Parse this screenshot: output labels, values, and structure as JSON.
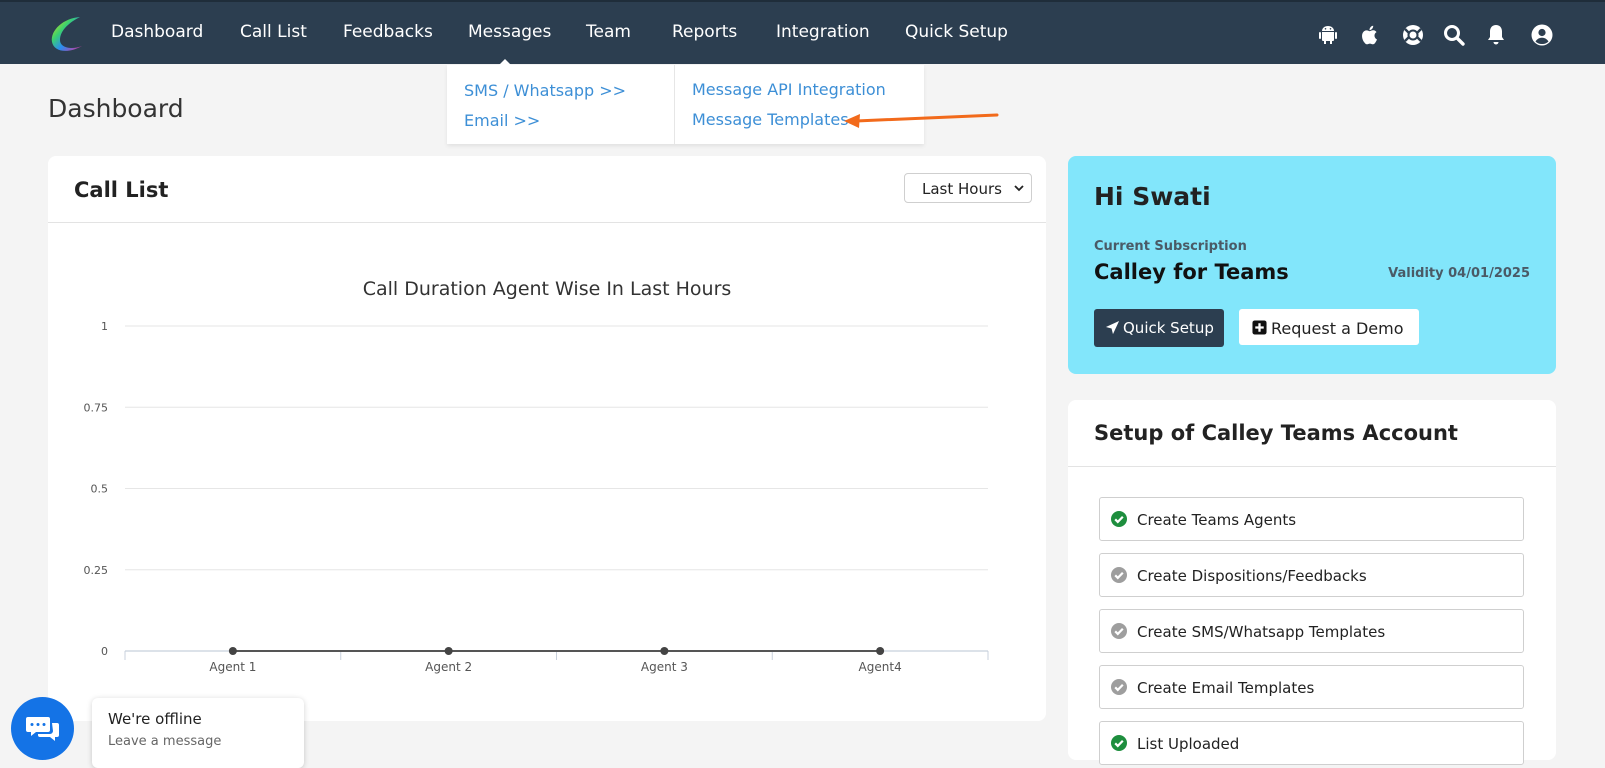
{
  "nav": {
    "items": [
      {
        "label": "Dashboard",
        "active": true
      },
      {
        "label": "Call List",
        "active": false
      },
      {
        "label": "Feedbacks",
        "active": false
      },
      {
        "label": "Messages",
        "active": true
      },
      {
        "label": "Team",
        "active": false
      },
      {
        "label": "Reports",
        "active": false
      },
      {
        "label": "Integration",
        "active": false
      },
      {
        "label": "Quick Setup",
        "active": false
      }
    ],
    "icons": [
      "android-icon",
      "apple-icon",
      "help-lifebuoy-icon",
      "search-icon",
      "notification-bell-icon",
      "user-account-icon"
    ],
    "accent_color": "#3d9be9",
    "bg_color": "#2c3e50"
  },
  "messages_menu": {
    "col1": [
      "SMS / Whatsapp >>",
      "Email >>"
    ],
    "col2": [
      "Message API Integration",
      "Message Templates"
    ]
  },
  "page": {
    "title": "Dashboard"
  },
  "call_list": {
    "title": "Call List",
    "filter_value": "Last Hours"
  },
  "chart_data": {
    "type": "line",
    "title": "Call Duration Agent Wise In Last Hours",
    "categories": [
      "Agent 1",
      "Agent 2",
      "Agent 3",
      "Agent4"
    ],
    "series": [
      {
        "values": [
          0,
          0,
          0,
          0
        ]
      }
    ],
    "ylim": [
      0,
      1
    ],
    "yticks": [
      "1",
      "0.75",
      "0.5",
      "0.25",
      "0"
    ],
    "grid": true,
    "xlabel": "",
    "ylabel": ""
  },
  "welcome": {
    "greeting": "Hi Swati",
    "subscription_label": "Current Subscription",
    "plan": "Calley for Teams",
    "validity": "Validity 04/01/2025",
    "quick_setup_label": "Quick Setup",
    "request_demo_label": "Request a Demo",
    "bg_color": "#82e6fb"
  },
  "setup": {
    "title": "Setup of Calley Teams Account",
    "items": [
      {
        "label": "Create Teams Agents",
        "done": true
      },
      {
        "label": "Create Dispositions/Feedbacks",
        "done": false
      },
      {
        "label": "Create SMS/Whatsapp Templates",
        "done": false
      },
      {
        "label": "Create Email Templates",
        "done": false
      },
      {
        "label": "List Uploaded",
        "done": true
      }
    ],
    "done_color": "#1e8e3e",
    "pending_color": "#9e9e9e"
  },
  "chat": {
    "title": "We're offline",
    "subtitle": "Leave a message"
  }
}
